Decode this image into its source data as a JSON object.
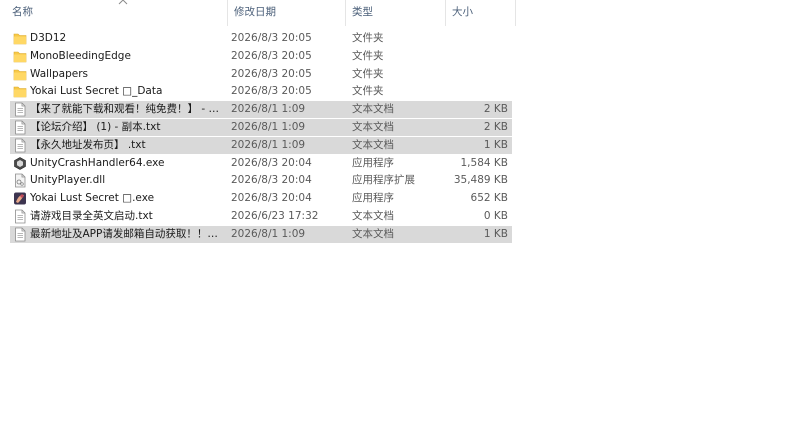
{
  "header": {
    "name": "名称",
    "date": "修改日期",
    "type": "类型",
    "size": "大小"
  },
  "files": [
    {
      "icon": "folder-icon",
      "name": "D3D12",
      "date": "2026/8/3 20:05",
      "type": "文件夹",
      "size": "",
      "selected": false
    },
    {
      "icon": "folder-icon",
      "name": "MonoBleedingEdge",
      "date": "2026/8/3 20:05",
      "type": "文件夹",
      "size": "",
      "selected": false
    },
    {
      "icon": "folder-icon",
      "name": "Wallpapers",
      "date": "2026/8/3 20:05",
      "type": "文件夹",
      "size": "",
      "selected": false
    },
    {
      "icon": "folder-icon",
      "name": "Yokai Lust Secret □_Data",
      "date": "2026/8/3 20:05",
      "type": "文件夹",
      "size": "",
      "selected": false
    },
    {
      "icon": "text-file-icon",
      "name": "【来了就能下载和观看！纯免费！】 - 副本.txt",
      "date": "2026/8/1 1:09",
      "type": "文本文档",
      "size": "2 KB",
      "selected": true
    },
    {
      "icon": "text-file-icon",
      "name": "【论坛介绍】 (1) - 副本.txt",
      "date": "2026/8/1 1:09",
      "type": "文本文档",
      "size": "2 KB",
      "selected": true
    },
    {
      "icon": "text-file-icon",
      "name": "【永久地址发布页】 .txt",
      "date": "2026/8/1 1:09",
      "type": "文本文档",
      "size": "1 KB",
      "selected": true
    },
    {
      "icon": "unity-crash-handler-icon",
      "name": "UnityCrashHandler64.exe",
      "date": "2026/8/3 20:04",
      "type": "应用程序",
      "size": "1,584 KB",
      "selected": false
    },
    {
      "icon": "dll-file-icon",
      "name": "UnityPlayer.dll",
      "date": "2026/8/3 20:04",
      "type": "应用程序扩展",
      "size": "35,489 KB",
      "selected": false
    },
    {
      "icon": "game-exe-icon",
      "name": "Yokai Lust Secret □.exe",
      "date": "2026/8/3 20:04",
      "type": "应用程序",
      "size": "652 KB",
      "selected": false
    },
    {
      "icon": "text-file-icon",
      "name": "请游戏目录全英文启动.txt",
      "date": "2026/6/23 17:32",
      "type": "文本文档",
      "size": "0 KB",
      "selected": false
    },
    {
      "icon": "text-file-icon",
      "name": "最新地址及APP请发邮箱自动获取！！！.txt",
      "date": "2026/8/1 1:09",
      "type": "文本文档",
      "size": "1 KB",
      "selected": true
    }
  ]
}
